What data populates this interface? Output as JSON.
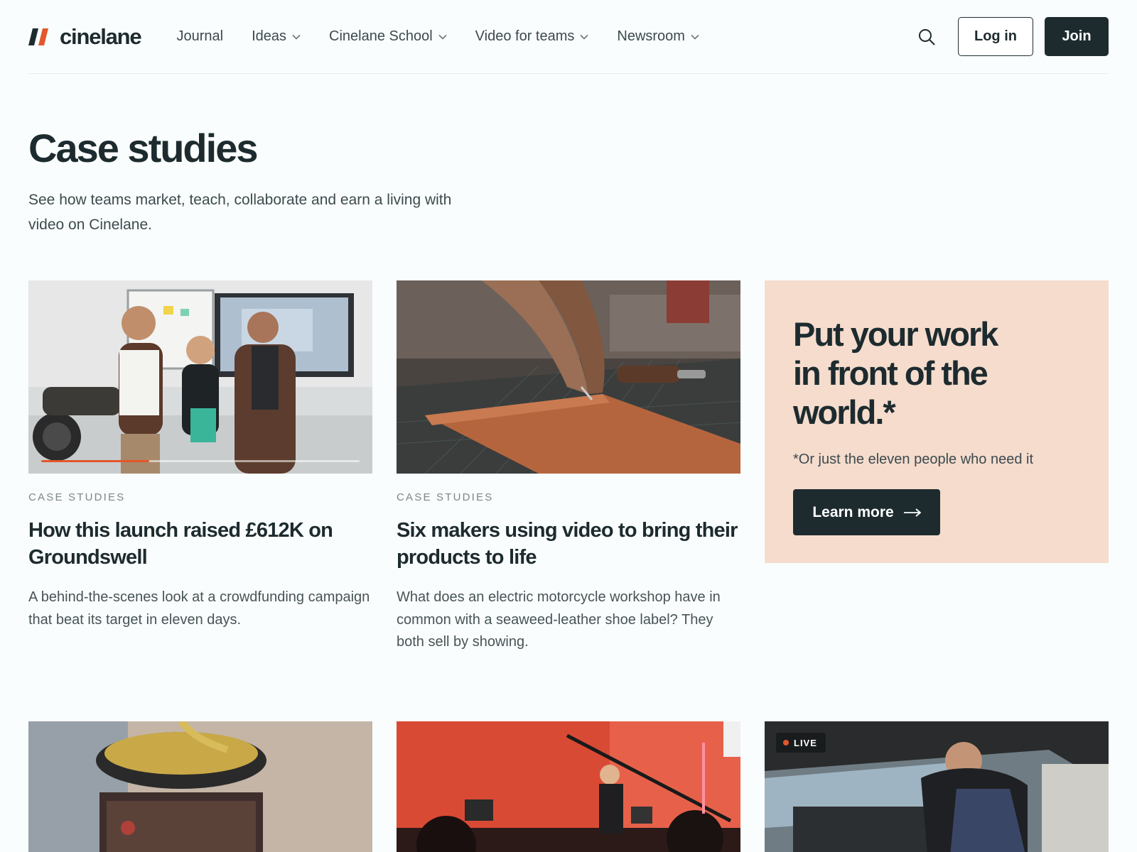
{
  "brand": {
    "name": "cinelane",
    "accent": "#e2572b",
    "dark": "#1d2b2f"
  },
  "nav": {
    "items": [
      {
        "label": "Journal",
        "has_menu": false
      },
      {
        "label": "Ideas",
        "has_menu": true
      },
      {
        "label": "Cinelane School",
        "has_menu": true
      },
      {
        "label": "Video for teams",
        "has_menu": true
      },
      {
        "label": "Newsroom",
        "has_menu": true
      }
    ],
    "search_icon": "search-icon",
    "login_label": "Log in",
    "join_label": "Join"
  },
  "hero": {
    "title": "Case studies",
    "intro": "See how teams market, teach, collaborate and earn a living with video on Cinelane."
  },
  "cards": [
    {
      "eyebrow": "CASE STUDIES",
      "title": "How this launch raised £612K on Groundswell",
      "desc": "A behind-the-scenes look at a crowdfunding campaign that beat its target in eleven days.",
      "video_progress": 0.34
    },
    {
      "eyebrow": "CASE STUDIES",
      "title": "Six makers using video to bring their products to life",
      "desc": "What does an electric motorcycle workshop have in common with a seaweed-leather shoe label? They both sell by showing."
    }
  ],
  "promo": {
    "title": "Put your work in front of the world.*",
    "note": "*Or just the eleven people who need it",
    "button_label": "Learn more",
    "background": "#f5dccd"
  },
  "bottom_row": {
    "live_badge": "LIVE"
  }
}
